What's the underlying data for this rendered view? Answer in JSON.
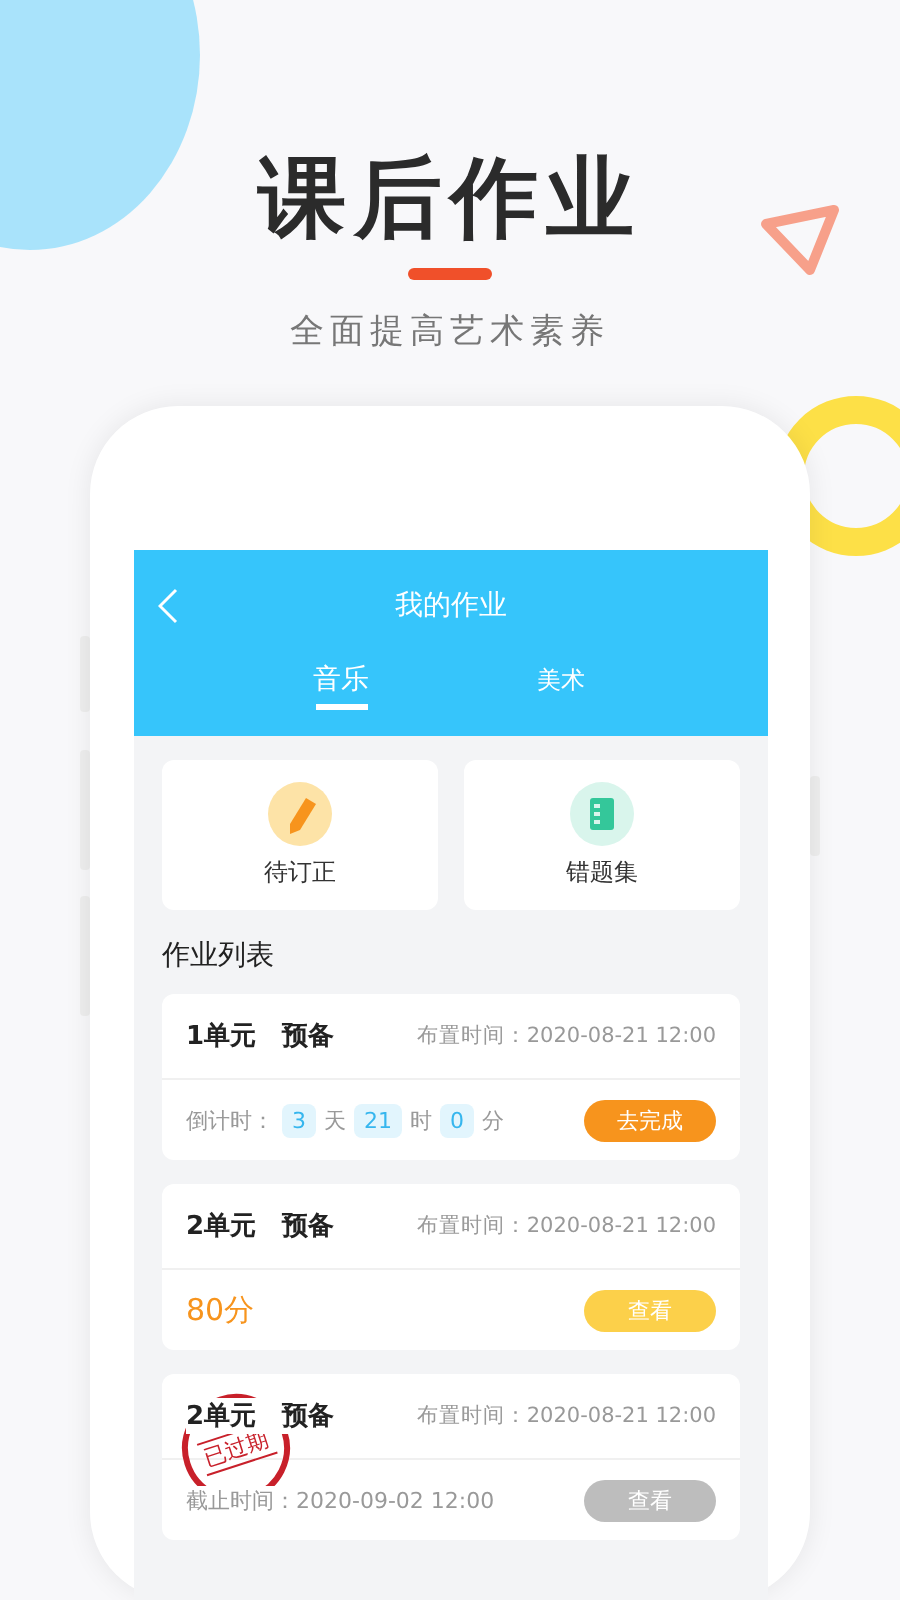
{
  "headline": "课后作业",
  "subtitle": "全面提高艺术素养",
  "app": {
    "title": "我的作业",
    "tabs": [
      {
        "label": "音乐",
        "selected": true
      },
      {
        "label": "美术",
        "selected": false
      }
    ],
    "shortcuts": [
      {
        "kind": "pencil",
        "label": "待订正"
      },
      {
        "kind": "notebook",
        "label": "错题集"
      }
    ],
    "section_title": "作业列表",
    "assignments": [
      {
        "kind": "countdown",
        "title": "1单元　预备",
        "assigned": "布置时间：2020-08-21 12:00",
        "countdown_label": "倒计时：",
        "days": "3",
        "days_unit": "天",
        "hours": "21",
        "hours_unit": "时",
        "minutes": "0",
        "minutes_unit": "分",
        "button": "去完成"
      },
      {
        "kind": "score",
        "title": "2单元　预备",
        "assigned": "布置时间：2020-08-21 12:00",
        "score": "80分",
        "button": "查看"
      },
      {
        "kind": "expired",
        "title": "2单元　预备",
        "assigned": "布置时间：2020-08-21 12:00",
        "stamp": "已过期",
        "deadline": "截止时间：2020-09-02 12:00",
        "button": "查看"
      }
    ]
  }
}
